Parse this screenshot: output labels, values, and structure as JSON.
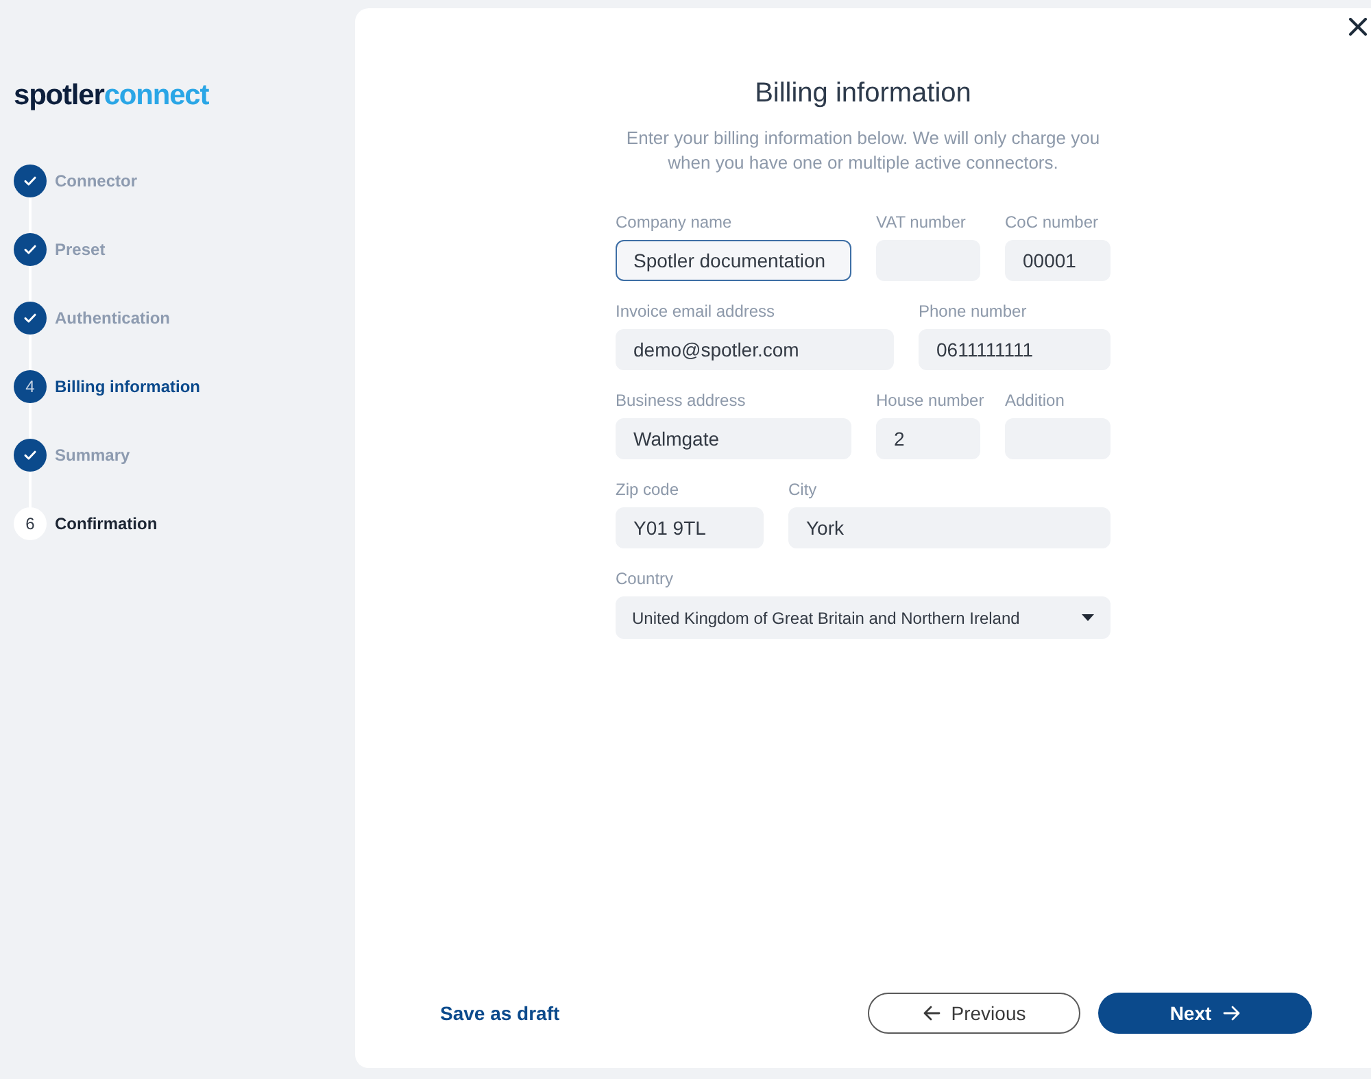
{
  "logo": {
    "dark_part": "spotler",
    "light_part": "connect"
  },
  "steps": [
    {
      "label": "Connector",
      "completed": true,
      "selected": false
    },
    {
      "label": "Preset",
      "completed": true,
      "selected": false
    },
    {
      "label": "Authentication",
      "completed": true,
      "selected": false
    },
    {
      "label": "Billing information",
      "completed": false,
      "selected": true,
      "number": "4"
    },
    {
      "label": "Summary",
      "completed": true,
      "selected": false
    },
    {
      "label": "Confirmation",
      "completed": false,
      "selected": false,
      "number": "6"
    }
  ],
  "form": {
    "title": "Billing information",
    "intro": "Enter your billing information below. We will only charge you when you have one or multiple active connectors.",
    "rows": [
      [
        {
          "label": "Company name",
          "value": "Spotler documentation",
          "focused": true
        },
        {
          "label": "VAT number",
          "focused": false
        },
        {
          "label": "CoC number",
          "value": "00001",
          "focused": false
        }
      ],
      [
        {
          "label": "Invoice email address",
          "value": "demo@spotler.com",
          "focused": false
        },
        {
          "label": "Phone number",
          "value": "0611111111",
          "focused": false
        }
      ],
      [
        {
          "label": "Business address",
          "value": "Walmgate",
          "focused": false
        },
        {
          "label": "House number",
          "value": "2",
          "focused": false
        },
        {
          "label": "Addition",
          "focused": false
        }
      ],
      [
        {
          "label": "Zip code",
          "value": "Y01 9TL",
          "focused": false
        },
        {
          "label": "City",
          "value": "York",
          "focused": false
        }
      ]
    ],
    "country": {
      "label": "Country",
      "value": "United Kingdom of Great Britain and Northern Ireland"
    }
  },
  "footer": {
    "save_draft": "Save as draft",
    "previous": "Previous",
    "next": "Next"
  }
}
